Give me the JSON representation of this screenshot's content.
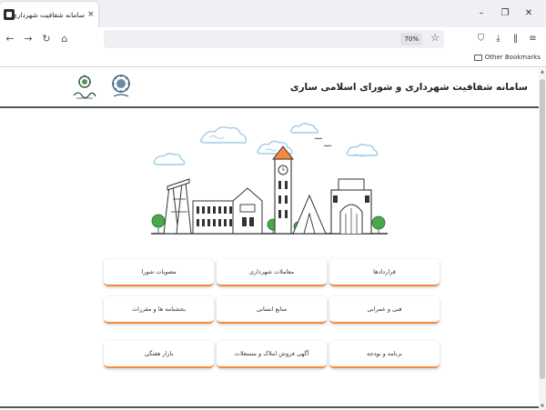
{
  "browser": {
    "tab_title": "سامانه شفافیت شهرداری و شورا",
    "tab_close": "×",
    "zoom": "70%",
    "bookmarks": {
      "other": "Other Bookmarks"
    },
    "window": {
      "minimize": "–",
      "maximize": "❐",
      "close": "✕"
    }
  },
  "site": {
    "title": "سامانه شفافیت شهرداری و شورای اسلامی ساری"
  },
  "cards": [
    {
      "label": "قراردادها"
    },
    {
      "label": "معاملات شهرداری"
    },
    {
      "label": "مصوبات شورا"
    },
    {
      "label": "فنی و عمرانی"
    },
    {
      "label": "منابع انسانی"
    },
    {
      "label": "بخشنامه ها و مقررات"
    },
    {
      "label": "برنامه و بودجه"
    },
    {
      "label": "آگهی فروش املاک و مستغلات"
    },
    {
      "label": "بازار هفتگی"
    }
  ],
  "colors": {
    "card_accent": "#f58a3c",
    "header_rule": "#4b5a55",
    "cloud": "#bfe0f0"
  }
}
